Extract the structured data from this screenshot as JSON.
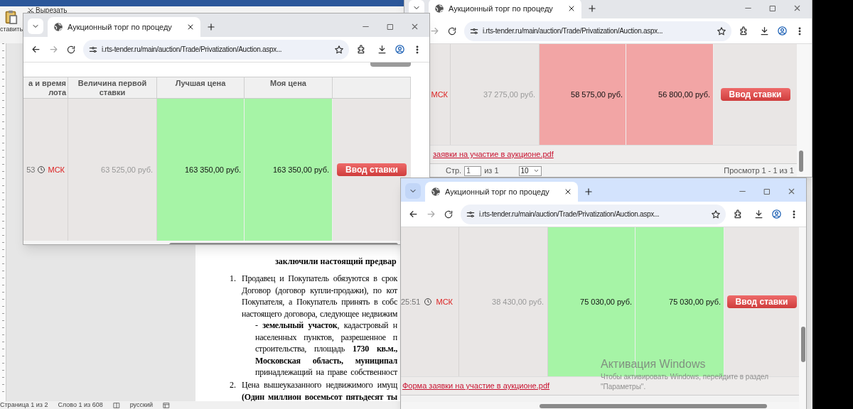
{
  "word": {
    "ribbon": {
      "cut": "Вырезать",
      "paste": "ставить"
    },
    "document": {
      "heading": "заключили настоящий предвар",
      "items": [
        {
          "number": "1.",
          "lines": [
            {
              "text": "Продавец и Покупатель обязуются в срок",
              "bold": false,
              "indent": false
            },
            {
              "text": "Договор (договор купли-продажи), по кот",
              "bold": false,
              "indent": false
            },
            {
              "text": "Покупателя, а Покупатель принять в собс",
              "bold": false,
              "indent": false
            },
            {
              "text": "настоящего договора, следующее недвижим",
              "bold": false,
              "indent": false
            },
            {
              "text": "- **земельный участок**, кадастровый н",
              "bold": false,
              "indent": true
            },
            {
              "text": "населенных пунктов, разрешенное п",
              "bold": false,
              "indent": true
            },
            {
              "text": "строительства, площадь **1730 кв.м.,**",
              "bold": false,
              "indent": true
            },
            {
              "text": "Московская область, муниципал",
              "bold": true,
              "indent": true
            },
            {
              "text": "принадлежащий на праве собственност",
              "bold": false,
              "indent": true
            }
          ]
        },
        {
          "number": "2.",
          "lines": [
            {
              "text": "Цена вышеуказанного недвижимого имущ",
              "bold": false,
              "indent": false
            },
            {
              "text": "(Один миллион восемьсот пятьдесят ты",
              "bold": true,
              "indent": false
            }
          ]
        }
      ]
    },
    "status_bar": [
      "Страница 1 из 2",
      "Слово 1 из 608",
      "русский"
    ]
  },
  "browser_windows": [
    {
      "active": false,
      "tab_title": "Аукционный торг по процеду",
      "url": "i.rts-tender.ru/main/auction/Trade/Privatization/Auction.aspx...",
      "columns": [
        "а и время лота",
        "Величина первой ставки",
        "Лучшая цена",
        "Моя цена"
      ],
      "row": {
        "time": "53",
        "zone": "МСК",
        "first_bid": "63 525,00 руб.",
        "best_price": "163 350,00 руб.",
        "my_price": "163 350,00 руб.",
        "leading": true,
        "button": "Ввод ставки"
      }
    },
    {
      "active": false,
      "tab_title": "Аукционный торг по процеду",
      "url": "i.rts-tender.ru/main/auction/Trade/Privatization/Auction.aspx...",
      "row": {
        "zone": "МСК",
        "first_bid": "37 275,00 руб.",
        "best_price": "58 575,00 руб.",
        "my_price": "56 800,00 руб.",
        "leading": false,
        "button": "Ввод ставки"
      },
      "link": "заявки на участие в аукционе.pdf",
      "pager": {
        "page_label": "Стр.",
        "page": "1",
        "of": "из 1",
        "page_size": "10",
        "summary": "Просмотр 1 - 1 из 1"
      }
    },
    {
      "active": true,
      "tab_title": "Аукционный торг по процеду",
      "url": "i.rts-tender.ru/main/auction/Trade/Privatization/Auction.aspx...",
      "row": {
        "time": "25:51",
        "zone": "МСК",
        "first_bid": "38 430,00 руб.",
        "best_price": "75 030,00 руб.",
        "my_price": "75 030,00 руб.",
        "leading": true,
        "button": "Ввод ставки"
      },
      "link": "Форма заявки на участие в аукционе.pdf"
    }
  ],
  "os_notice": {
    "title": "Активация Windows",
    "text": "Чтобы активировать Windows, перейдите в раздел \"Параметры\"."
  }
}
